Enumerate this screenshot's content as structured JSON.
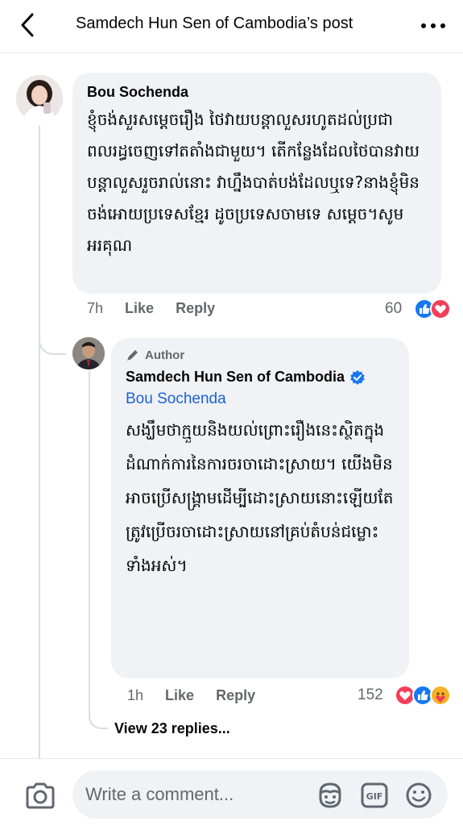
{
  "header": {
    "title": "Samdech Hun Sen of Cambodia’s post",
    "back_icon": "chevron-left-icon",
    "more_icon": "ellipsis-horizontal-icon"
  },
  "comment": {
    "author": "Bou Sochenda",
    "text": "ខ្ញុំចង់សួរសម្តេចរឿង ថៃវាយបន្តាលួសរហូតដល់ប្រជាពលរដ្ធចេញទៅតតាំងជាមួយ។ តើកន្លែងដែលថៃបានវាយបន្តាលួសរួចរាល់នោះ វាហ្នឹងបាត់បង់ដែលឬទេ?នាងខ្ញុំមិនចង់អោយប្រទេសខ្មែរ ដូចប្រទេសចាមទេ សម្តេច។សូមអរគុណ",
    "time": "7h",
    "like_label": "Like",
    "reply_label": "Reply",
    "reaction_count": "60",
    "reactions": [
      "like",
      "love"
    ]
  },
  "reply": {
    "badge": "Author",
    "author": "Samdech Hun Sen of Cambodia",
    "verified_icon": "verified-badge-icon",
    "mention": "Bou Sochenda",
    "text": "សង្ឃឹមថាក្មួយនិងយល់ព្រោះរឿងនេះស្ថិតក្នុងដំណាក់ការនៃការចរចាដោះស្រាយ។ យើងមិនអាចប្រើសង្គ្រាមដើម្បីដោះស្រាយនោះឡើយតែត្រូវប្រើចរចាដោះស្រាយនៅគ្រប់តំបន់ជម្លោះទាំងអស់។",
    "time": "1h",
    "like_label": "Like",
    "reply_label": "Reply",
    "reaction_count": "152",
    "reactions": [
      "love",
      "like",
      "care"
    ]
  },
  "view_replies": "View 23 replies...",
  "composer": {
    "placeholder": "Write a comment...",
    "icons": [
      "camera-icon",
      "avatar-sticker-icon",
      "gif-icon",
      "emoji-icon"
    ]
  },
  "colors": {
    "like_blue": "#1877f2",
    "love_red": "#f33e58",
    "mention_blue": "#1a63d8",
    "bubble_gray": "#f0f2f5",
    "meta_gray": "#65676b"
  }
}
